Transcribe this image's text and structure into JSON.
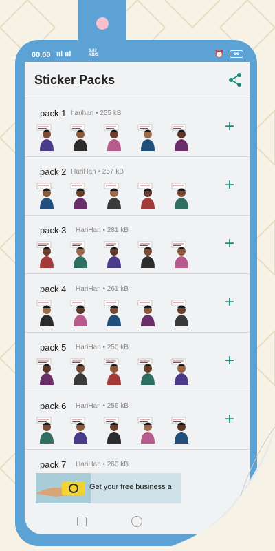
{
  "status_bar": {
    "time": "00.00",
    "signal": "ııl ııl",
    "speed_value": "0.87",
    "speed_unit": "KB/S",
    "battery": "66",
    "icons": [
      "signal-icon",
      "wifi-icon",
      "alarm-icon",
      "battery-icon"
    ]
  },
  "appbar": {
    "title": "Sticker Packs",
    "share_icon": "share-icon"
  },
  "packs": [
    {
      "name": "pack 1",
      "meta": "harihan • 255 kB"
    },
    {
      "name": "pack 2",
      "meta": "HariHan • 257 kB"
    },
    {
      "name": "pack 3",
      "meta": "HariHan • 281 kB"
    },
    {
      "name": "pack 4",
      "meta": "HariHan • 261 kB"
    },
    {
      "name": "pack 5",
      "meta": "HariHan • 250 kB"
    },
    {
      "name": "pack 6",
      "meta": "HariHan • 256 kB"
    },
    {
      "name": "pack 7",
      "meta": "HariHan • 260 kB"
    }
  ],
  "add_label": "+",
  "ad": {
    "text": "Get your free business a"
  },
  "colors": {
    "phone": "#5da2d5",
    "accent": "#1a8a76",
    "screen": "#f1f2f4",
    "background": "#f6f2e6"
  }
}
